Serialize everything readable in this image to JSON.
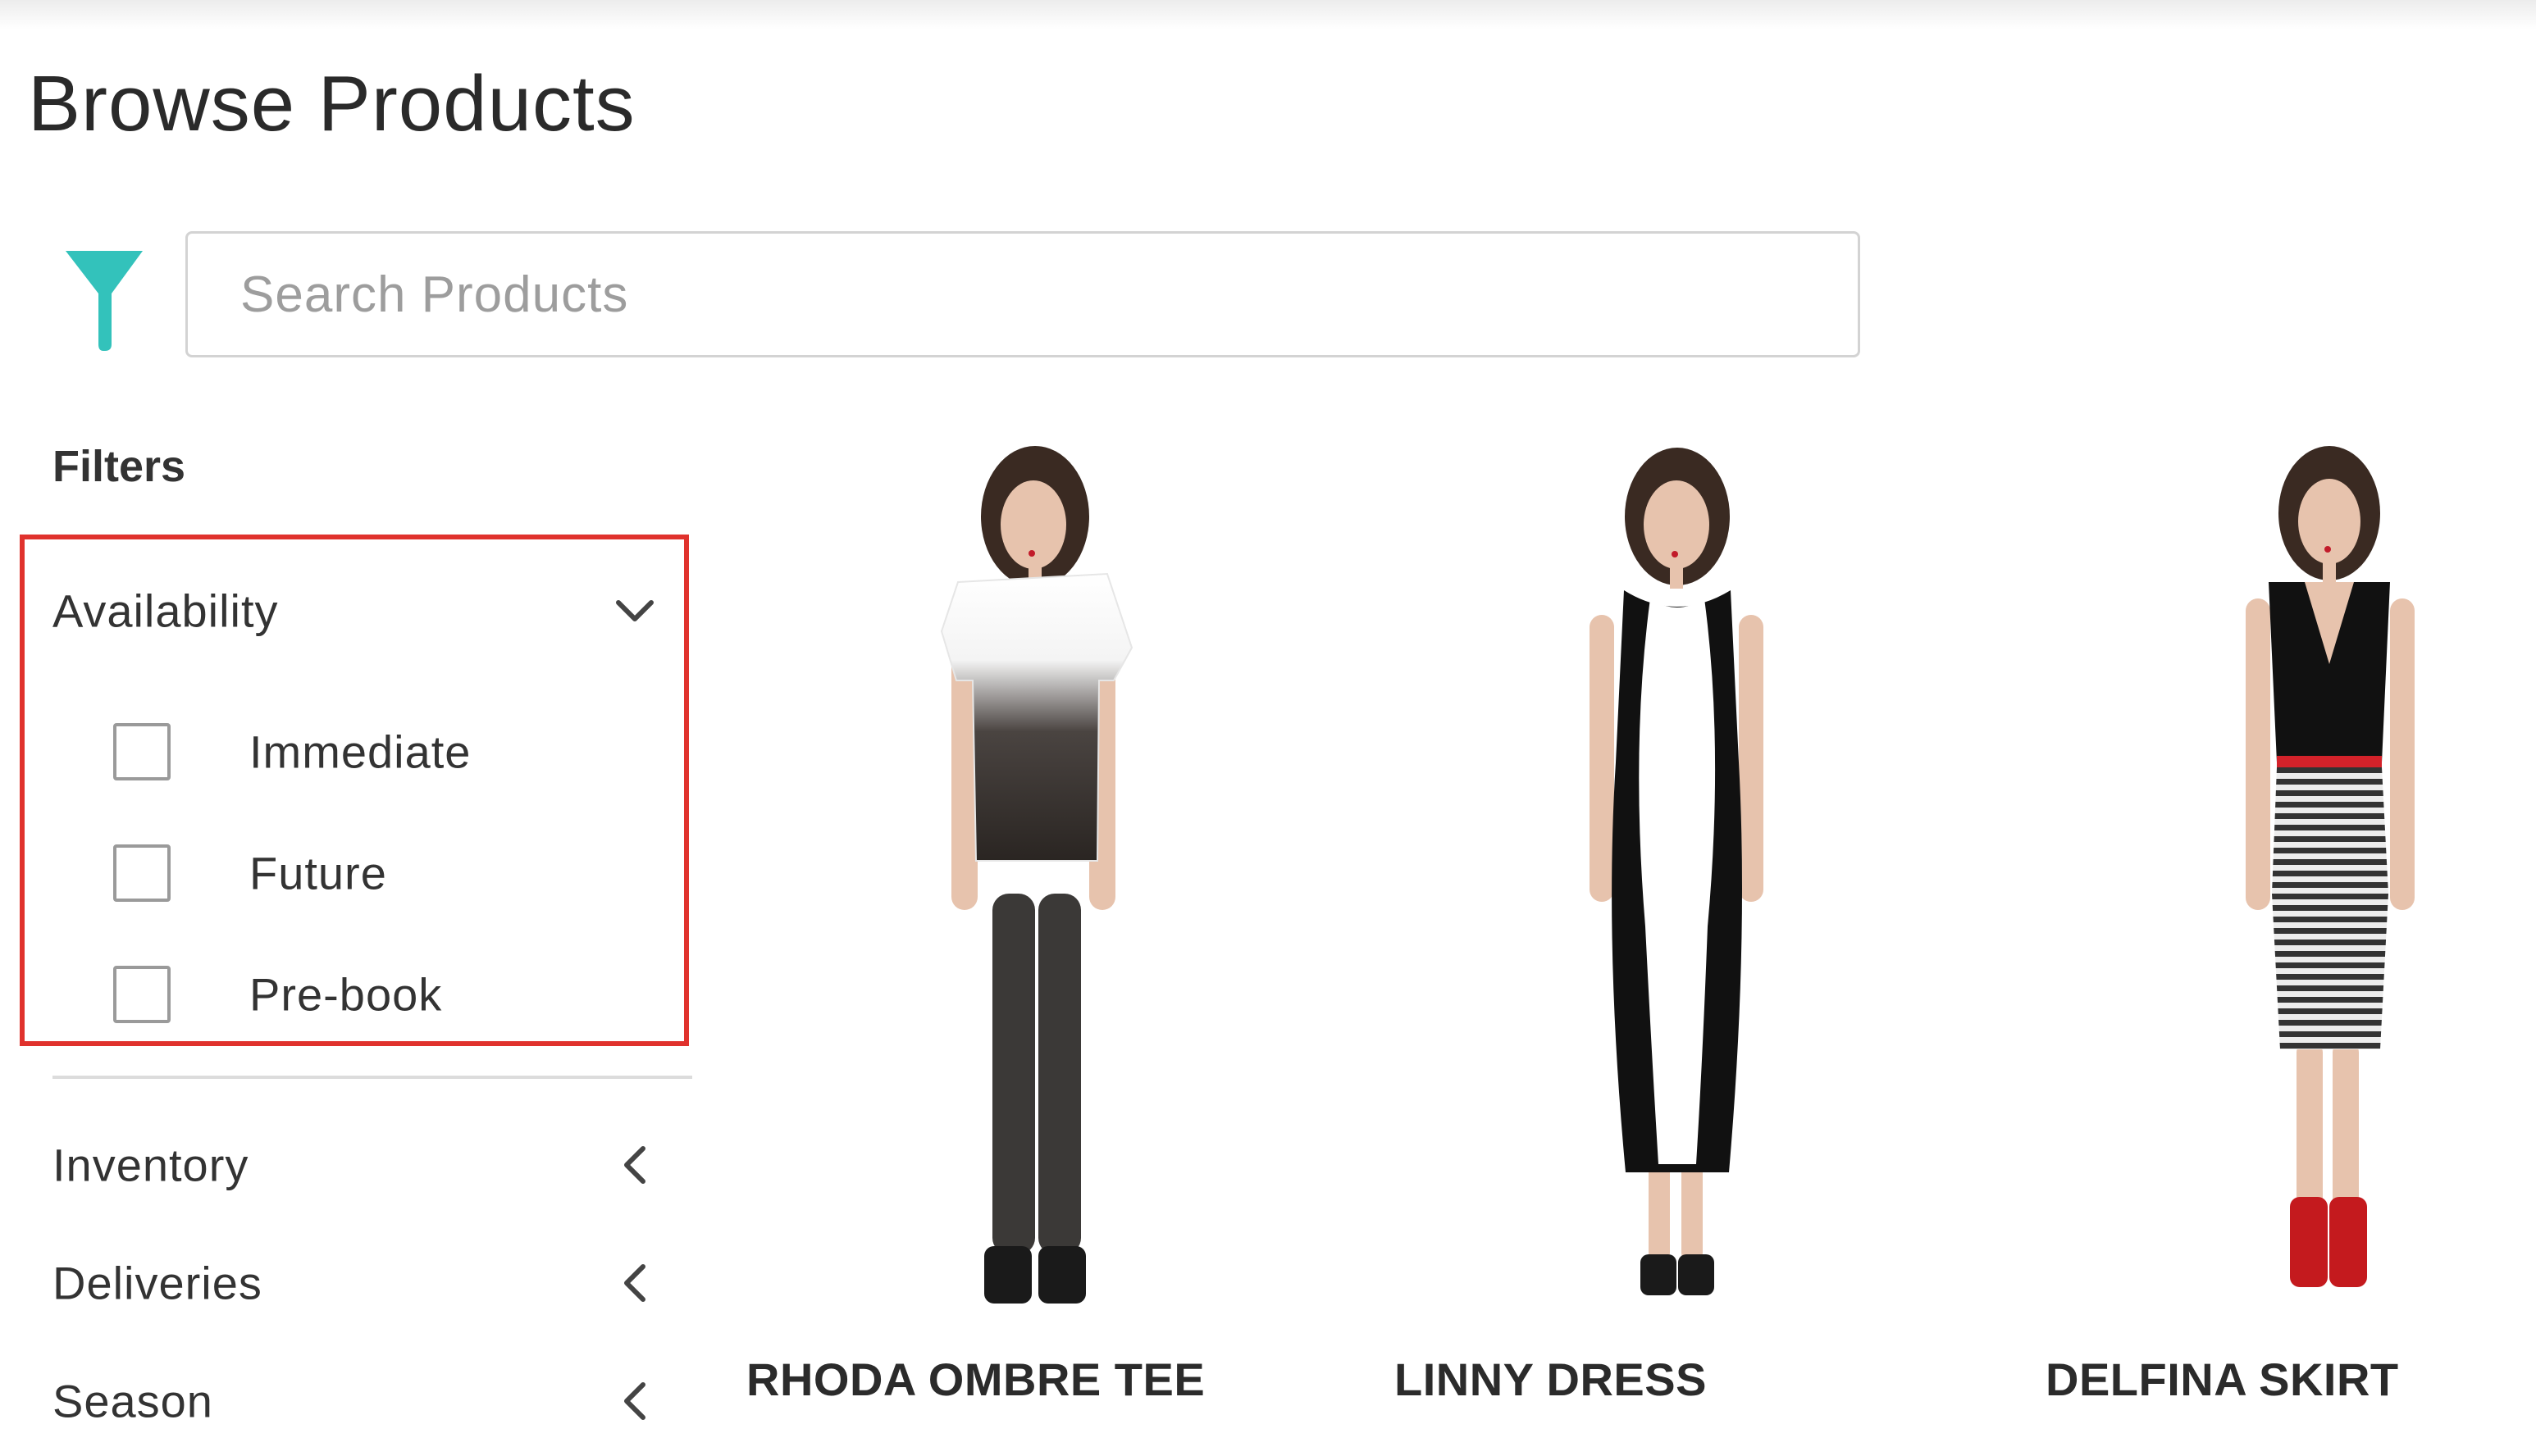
{
  "page": {
    "title": "Browse Products"
  },
  "search": {
    "placeholder": "Search Products",
    "value": ""
  },
  "filter_icon": {
    "icon": "funnel-icon",
    "color": "#33c2bb"
  },
  "filters": {
    "title": "Filters",
    "highlight_color": "#e0322d",
    "sections": [
      {
        "label": "Availability",
        "state": "expanded",
        "icon": "chevron-down-icon",
        "options": [
          {
            "label": "Immediate",
            "checked": false
          },
          {
            "label": "Future",
            "checked": false
          },
          {
            "label": "Pre-book",
            "checked": false
          }
        ]
      },
      {
        "label": "Inventory",
        "state": "collapsed",
        "icon": "chevron-left-icon"
      },
      {
        "label": "Deliveries",
        "state": "collapsed",
        "icon": "chevron-left-icon"
      },
      {
        "label": "Season",
        "state": "collapsed",
        "icon": "chevron-left-icon"
      }
    ]
  },
  "products": [
    {
      "name": "RHODA OMBRE TEE",
      "image": "model-wearing-ombre-tee-and-black-pants"
    },
    {
      "name": "LINNY DRESS",
      "image": "model-wearing-black-and-white-dress"
    },
    {
      "name": "DELFINA SKIRT",
      "image": "model-wearing-striped-skirt-and-red-boots"
    }
  ]
}
